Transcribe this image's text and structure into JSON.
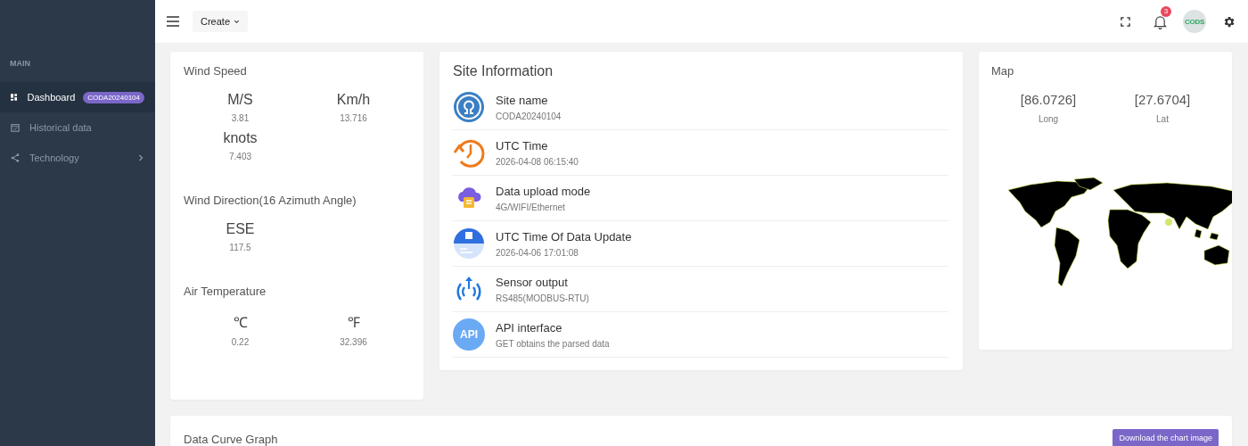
{
  "sidebar": {
    "section": "MAIN",
    "items": [
      {
        "kind": "dashboard",
        "label": "Dashboard",
        "badge": "CODA20240104",
        "selected": true
      },
      {
        "kind": "calendar",
        "label": "Historical data",
        "selected": false
      },
      {
        "kind": "share",
        "label": "Technology",
        "selected": false,
        "expanded": false
      }
    ]
  },
  "topbar": {
    "create_button": "Create",
    "notification_count": "3",
    "avatar_text": "CODS"
  },
  "wind_card": {
    "sections": [
      {
        "title": "Wind Speed",
        "readings": [
          {
            "unit": "M/S",
            "value": "3.81"
          },
          {
            "unit": "Km/h",
            "value": "13.716"
          },
          {
            "unit": "knots",
            "value": "7.403"
          }
        ]
      },
      {
        "title": "Wind Direction(16 Azimuth Angle)",
        "readings": [
          {
            "unit": "ESE",
            "value": "117.5"
          }
        ]
      },
      {
        "title": "Air Temperature",
        "readings": [
          {
            "unit": "℃",
            "value": "0.22"
          },
          {
            "unit": "℉",
            "value": "32.396"
          }
        ]
      }
    ]
  },
  "site_info": {
    "title": "Site Information",
    "items": [
      {
        "kind": "site",
        "label": "Site name",
        "value": "CODA20240104"
      },
      {
        "kind": "clock",
        "label": "UTC Time",
        "value": "2026-04-08 06:15:40"
      },
      {
        "kind": "cloud",
        "label": "Data upload mode",
        "value": "4G/WIFI/Ethernet"
      },
      {
        "kind": "update",
        "label": "UTC Time Of Data Update",
        "value": "2026-04-06 17:01:08"
      },
      {
        "kind": "signal",
        "label": "Sensor output",
        "value": "RS485(MODBUS-RTU)"
      },
      {
        "kind": "api",
        "label": "API interface",
        "value": "GET obtains the parsed data",
        "icon_text": "API"
      }
    ]
  },
  "map": {
    "title": "Map",
    "coordinates": [
      {
        "value": "[86.0726]",
        "label": "Long"
      },
      {
        "value": "[27.6704]",
        "label": "Lat"
      }
    ]
  },
  "curve_card": {
    "title": "Data Curve Graph",
    "download_button": "Download the chart image"
  }
}
